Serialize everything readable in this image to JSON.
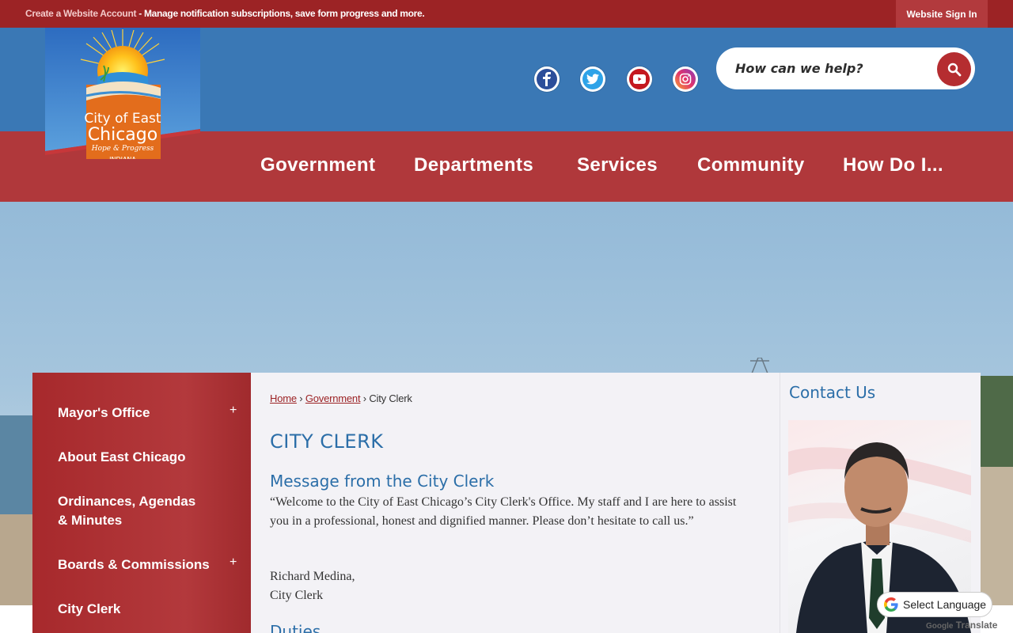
{
  "topbar": {
    "create_account_link": "Create a Website Account",
    "create_account_desc": " - Manage notification subscriptions, save form progress and more.",
    "sign_in_label": "Website Sign In"
  },
  "logo": {
    "line1": "City of East",
    "line2": "Chicago",
    "tagline": "Hope & Progress",
    "state": "INDIANA"
  },
  "social": {
    "facebook_icon": "facebook-icon",
    "twitter_icon": "twitter-icon",
    "youtube_icon": "youtube-icon",
    "instagram_icon": "instagram-icon"
  },
  "search": {
    "placeholder": "How can we help?",
    "icon": "search-icon"
  },
  "nav": {
    "items": [
      "Government",
      "Departments",
      "Services",
      "Community",
      "How Do I..."
    ]
  },
  "sidebar": {
    "items": [
      {
        "label": "Mayor's Office",
        "expandable": "+"
      },
      {
        "label": "About East Chicago"
      },
      {
        "label_line1": "Ordinances, Agendas",
        "label_line2": "& Minutes"
      },
      {
        "label": "Boards & Commissions",
        "expandable": "+"
      },
      {
        "label": "City Clerk"
      }
    ]
  },
  "breadcrumb": {
    "home": "Home",
    "sep1": " › ",
    "government": "Government",
    "sep2": " › ",
    "current": "City Clerk"
  },
  "main": {
    "title": "CITY CLERK",
    "subheading": "Message from the City Clerk",
    "message": "“Welcome to the City of East Chicago’s City Clerk's Office. My staff and I are here to assist you in a professional, honest and dignified manner. Please don’t hesitate to call us.”",
    "signature_name": "Richard Medina,",
    "signature_title": "City Clerk",
    "next_heading": "Duties"
  },
  "right": {
    "contact_title": "Contact Us"
  },
  "translate": {
    "label": "Select Language",
    "powered_google": "Google",
    "powered_translate": " Translate"
  },
  "colors": {
    "topbar": "#9c2325",
    "header_blue": "#3a78b5",
    "nav_red": "#b0383b",
    "heading_blue": "#2b6ea8"
  }
}
